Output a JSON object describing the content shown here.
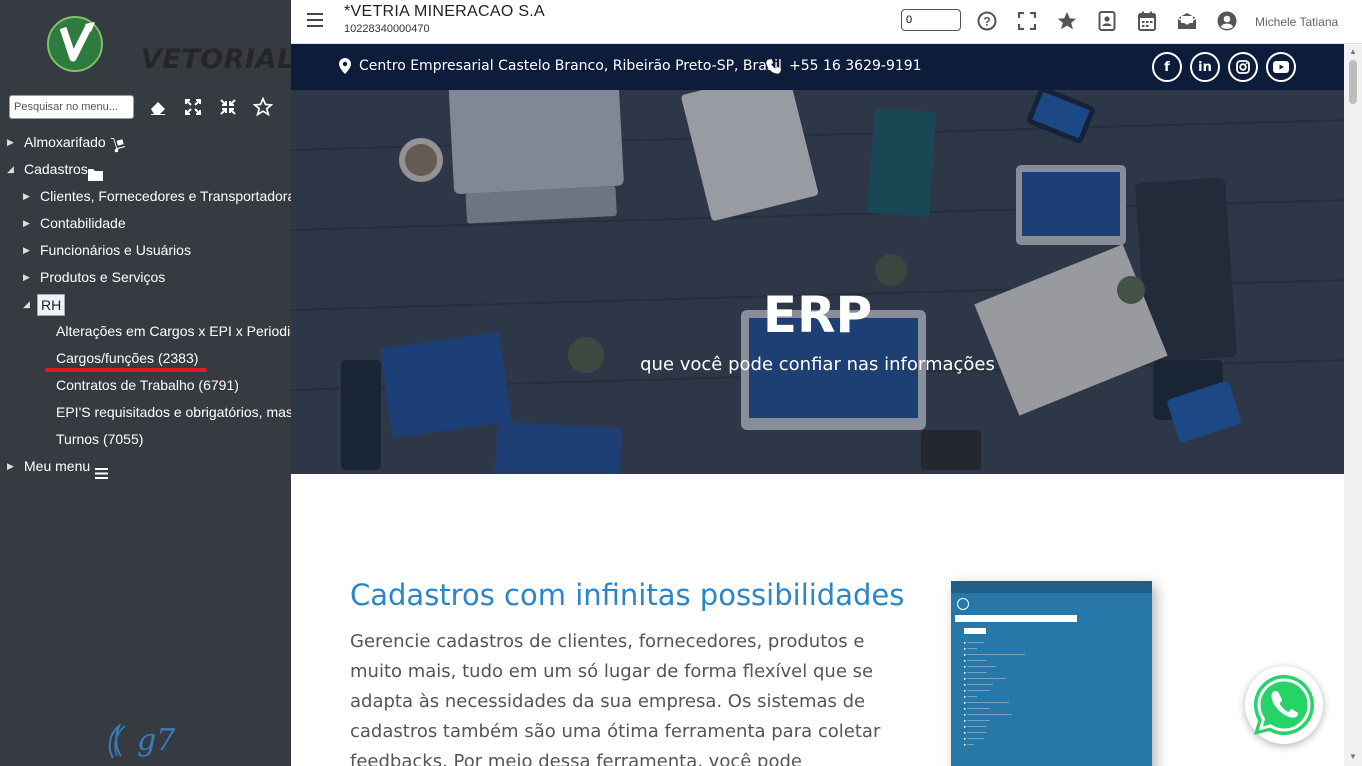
{
  "sidebar": {
    "logo_text": "VETORIAL",
    "search_placeholder": "Pesquisar no menu...",
    "tree": [
      {
        "label": "Almoxarifado",
        "level": 0,
        "expanded": false,
        "icon": "dolly-icon"
      },
      {
        "label": "Cadastros",
        "level": 0,
        "expanded": true,
        "icon": "folder-icon"
      },
      {
        "label": "Clientes, Fornecedores e Transportadora",
        "level": 1,
        "expanded": false
      },
      {
        "label": "Contabilidade",
        "level": 1,
        "expanded": false
      },
      {
        "label": "Funcionários e Usuários",
        "level": 1,
        "expanded": false
      },
      {
        "label": "Produtos e Serviços",
        "level": 1,
        "expanded": false
      },
      {
        "label": "RH",
        "level": 1,
        "expanded": true,
        "selected": true
      },
      {
        "label": "Alterações em Cargos x EPI x Periodic",
        "level": 2
      },
      {
        "label": "Cargos/funções (2383)",
        "level": 2,
        "highlight": true
      },
      {
        "label": "Contratos de Trabalho (6791)",
        "level": 2
      },
      {
        "label": "EPI'S requisitados e obrigatórios, mas",
        "level": 2
      },
      {
        "label": "Turnos (7055)",
        "level": 2
      },
      {
        "label": "Meu menu",
        "level": 0,
        "expanded": false,
        "icon": "bars-icon"
      }
    ],
    "footer_logo": "g7"
  },
  "topbar": {
    "company": "*VETRIA MINERACAO S.A",
    "cnpj": "10228340000470",
    "counter_value": "0",
    "username": "Michele Tatiana"
  },
  "site": {
    "address": "Centro Empresarial Castelo Branco, Ribeirão Preto-SP, Brasil",
    "phone": "+55 16 3629-9191",
    "hero_title": "ERP",
    "hero_subtitle": "que você pode confiar nas informações",
    "section_title": "Cadastros com infinitas possibilidades",
    "section_body": "Gerencie cadastros de clientes, fornecedores, produtos e muito mais, tudo em um só lugar de forma flexível que se adapta às necessidades da sua empresa. Os sistemas de cadastros também são uma ótima ferramenta para coletar feedbacks. Por meio dessa ferramenta, você pode"
  },
  "colors": {
    "sidebar_bg": "#353b41",
    "infobar_bg": "#0c1c3a",
    "accent_blue": "#2a86c9",
    "highlight_red": "#e11a22",
    "whatsapp_green": "#25d366"
  }
}
